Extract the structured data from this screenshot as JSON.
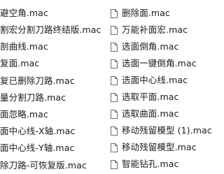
{
  "file_list": {
    "icon": "generic-file-icon",
    "left_column": [
      "避空角.mac",
      "割宏分割刀路终结版.mac",
      "剖曲线.mac",
      "复面.mac",
      "复已删除刀路.mac",
      "量分割刀路.mac",
      "面忽略.mac",
      "面中心线-X轴.mac",
      "面中心线-Y轴.mac",
      "除刀路-可恢复版.mac"
    ],
    "right_column": [
      "删除面.mac",
      "万能补面宏.mac",
      "选面倒角.mac",
      "选面一键倒角.mac",
      "选面中心线.mac",
      "选取平面.mac",
      "选取曲面.mac",
      "移动残留模型 (1).mac",
      "移动残留模型.mac",
      "智能钻孔.mac"
    ]
  }
}
